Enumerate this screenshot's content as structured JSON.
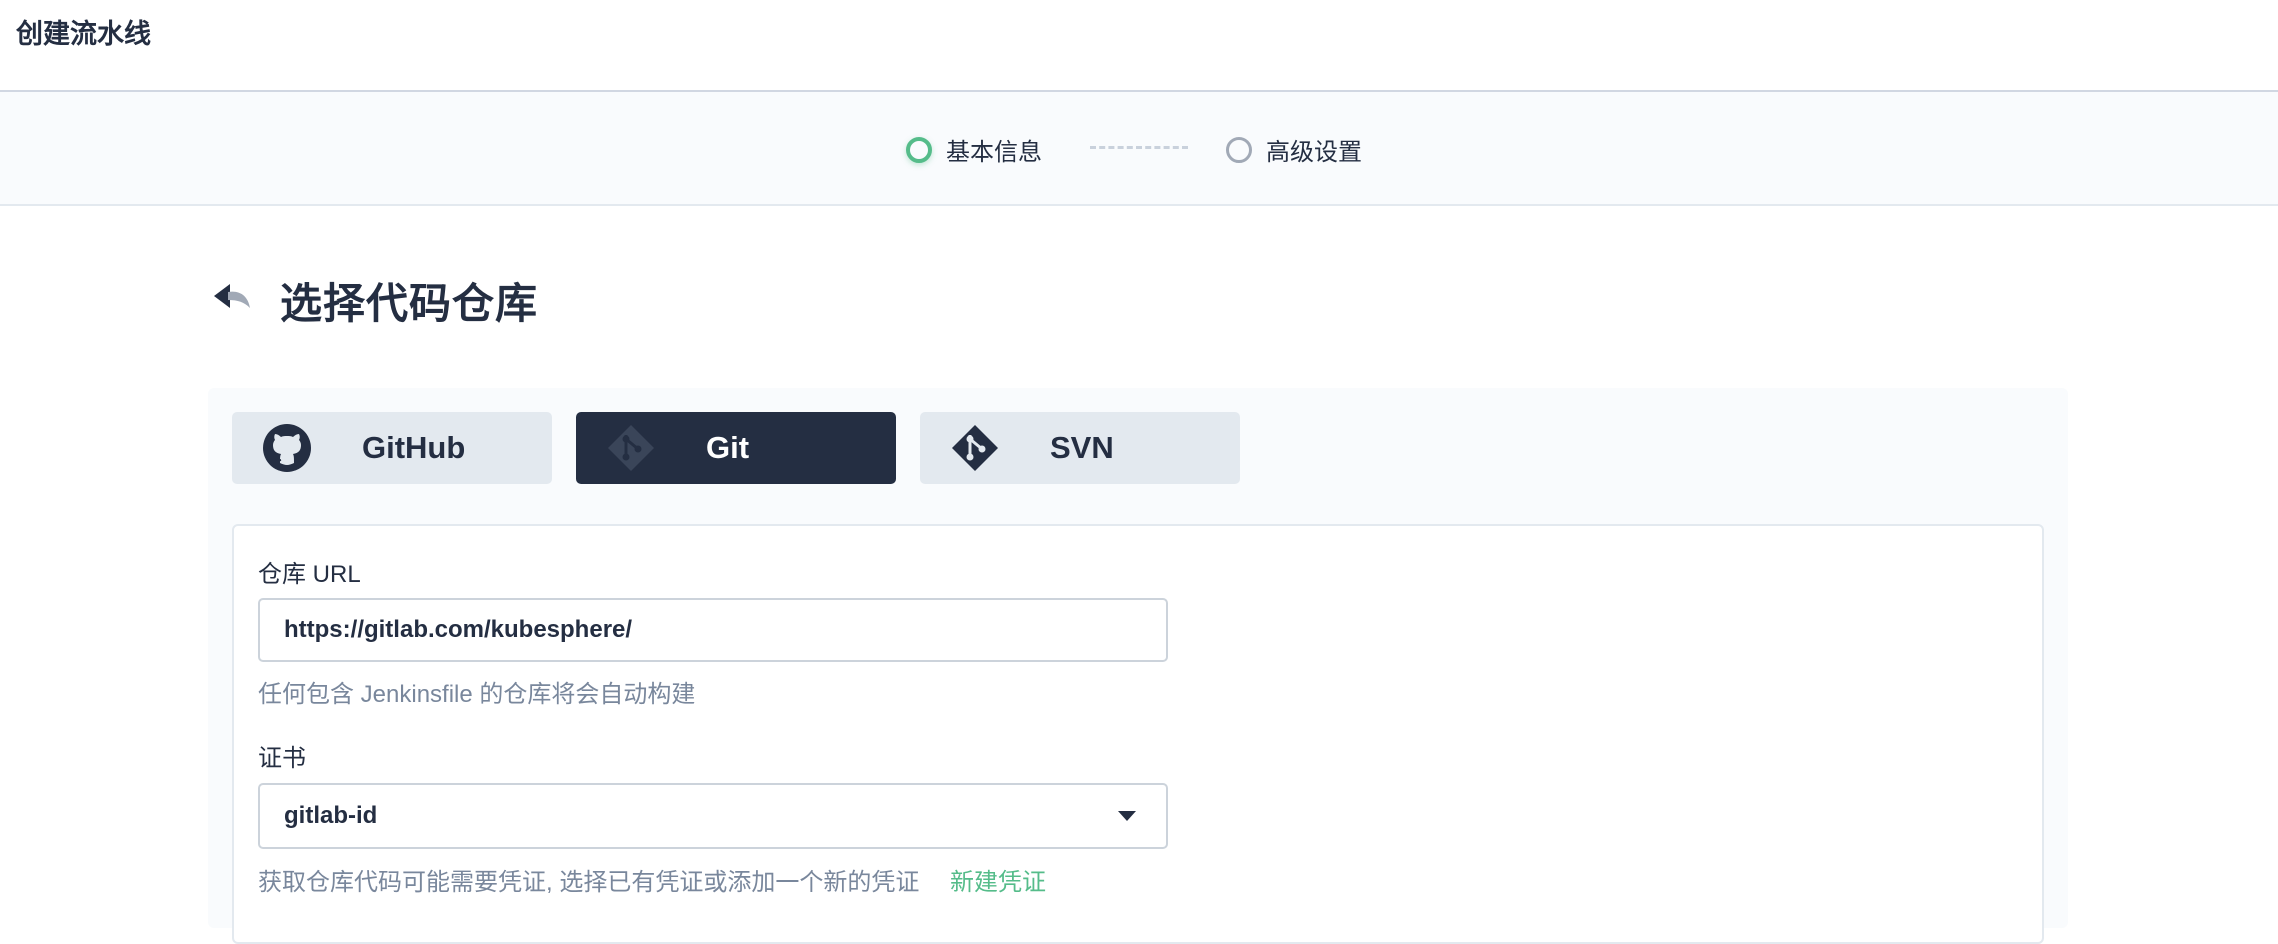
{
  "window": {
    "title": "创建流水线"
  },
  "steps": [
    {
      "label": "基本信息",
      "state": "active"
    },
    {
      "label": "高级设置",
      "state": "inactive"
    }
  ],
  "page": {
    "title": "选择代码仓库",
    "back_icon": "back-arrow-icon"
  },
  "source_tabs": [
    {
      "label": "GitHub",
      "icon": "github-icon",
      "selected": false
    },
    {
      "label": "Git",
      "icon": "git-icon",
      "selected": true
    },
    {
      "label": "SVN",
      "icon": "svn-icon",
      "selected": false
    }
  ],
  "form": {
    "repo_url": {
      "label": "仓库 URL",
      "value": "https://gitlab.com/kubesphere/",
      "help": "任何包含 Jenkinsfile 的仓库将会自动构建"
    },
    "credential": {
      "label": "证书",
      "selected": "gitlab-id",
      "help": "获取仓库代码可能需要凭证, 选择已有凭证或添加一个新的凭证",
      "create_link": "新建凭证"
    }
  },
  "colors": {
    "primary_dark": "#242e42",
    "accent_green": "#55bc8a",
    "muted_text": "#79879c",
    "tab_bg": "#e3e9ef"
  }
}
